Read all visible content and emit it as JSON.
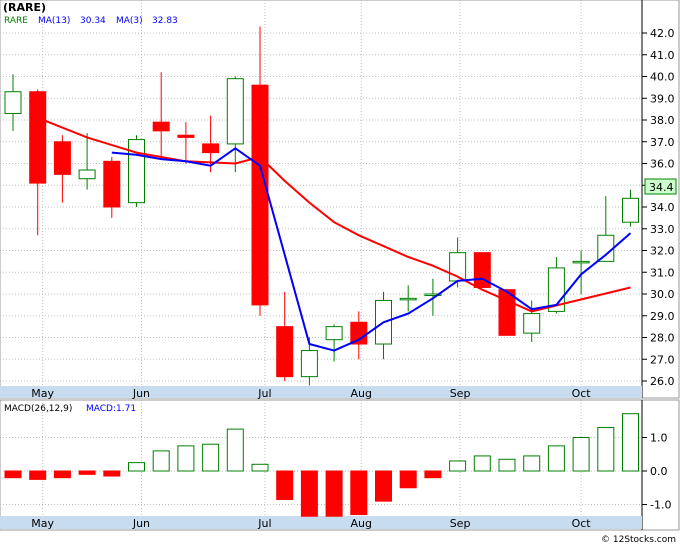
{
  "title": "(RARE)",
  "price_legend": {
    "ticker": "RARE",
    "ma13_label": "MA(13)",
    "ma13_value": "30.34",
    "ma3_label": "MA(3)",
    "ma3_value": "32.83"
  },
  "macd_legend": {
    "label": "MACD(26,12,9)",
    "value_label": "MACD:1.71"
  },
  "last_price_badge": "34.4",
  "watermark": "© 12Stocks.com",
  "colors": {
    "up": "#008000",
    "down": "#ff0000",
    "ma13": "#0000ff",
    "ma3": "#ff0000",
    "axis_band": "#c8dcf0",
    "grid": "#c0c0c0",
    "badge_bg": "#ccffcc"
  },
  "chart_data": {
    "type": "candlestick",
    "price_axis": {
      "ylim": [
        25.5,
        42.8
      ],
      "ticks": [
        "26.0",
        "27.0",
        "28.0",
        "29.0",
        "30.0",
        "31.0",
        "32.0",
        "33.0",
        "34.0",
        "35.0",
        "36.0",
        "37.0",
        "38.0",
        "39.0",
        "40.0",
        "41.0",
        "42.0"
      ]
    },
    "x_labels": [
      {
        "label": "May",
        "index": 1.2
      },
      {
        "label": "Jun",
        "index": 5.2
      },
      {
        "label": "Jul",
        "index": 10.2
      },
      {
        "label": "Aug",
        "index": 14.1
      },
      {
        "label": "Sep",
        "index": 18.1
      },
      {
        "label": "Oct",
        "index": 23.0
      }
    ],
    "candles": [
      {
        "o": 38.3,
        "h": 40.1,
        "l": 37.5,
        "c": 39.3
      },
      {
        "o": 39.3,
        "h": 39.4,
        "l": 32.7,
        "c": 35.1
      },
      {
        "o": 37.0,
        "h": 37.3,
        "l": 34.2,
        "c": 35.5
      },
      {
        "o": 35.3,
        "h": 37.4,
        "l": 34.8,
        "c": 35.7
      },
      {
        "o": 36.1,
        "h": 36.3,
        "l": 33.5,
        "c": 34.0
      },
      {
        "o": 34.2,
        "h": 37.3,
        "l": 34.0,
        "c": 37.1
      },
      {
        "o": 37.9,
        "h": 40.2,
        "l": 36.2,
        "c": 37.5
      },
      {
        "o": 37.3,
        "h": 37.9,
        "l": 36.0,
        "c": 37.2
      },
      {
        "o": 36.9,
        "h": 38.2,
        "l": 35.6,
        "c": 36.5
      },
      {
        "o": 36.9,
        "h": 40.0,
        "l": 35.6,
        "c": 39.9
      },
      {
        "o": 39.6,
        "h": 42.3,
        "l": 29.0,
        "c": 29.5
      },
      {
        "o": 28.5,
        "h": 30.1,
        "l": 26.0,
        "c": 26.2
      },
      {
        "o": 26.2,
        "h": 28.0,
        "l": 25.8,
        "c": 27.4
      },
      {
        "o": 27.9,
        "h": 28.6,
        "l": 26.9,
        "c": 28.5
      },
      {
        "o": 28.7,
        "h": 29.2,
        "l": 27.0,
        "c": 27.7
      },
      {
        "o": 27.7,
        "h": 30.1,
        "l": 27.0,
        "c": 29.7
      },
      {
        "o": 29.8,
        "h": 30.4,
        "l": 29.2,
        "c": 29.8
      },
      {
        "o": 30.0,
        "h": 30.7,
        "l": 29.0,
        "c": 30.0
      },
      {
        "o": 30.6,
        "h": 32.6,
        "l": 30.3,
        "c": 31.9
      },
      {
        "o": 31.9,
        "h": 31.9,
        "l": 30.3,
        "c": 30.3
      },
      {
        "o": 30.2,
        "h": 30.2,
        "l": 28.1,
        "c": 28.1
      },
      {
        "o": 28.2,
        "h": 29.7,
        "l": 27.8,
        "c": 29.1
      },
      {
        "o": 29.2,
        "h": 31.7,
        "l": 29.1,
        "c": 31.2
      },
      {
        "o": 31.5,
        "h": 32.0,
        "l": 30.0,
        "c": 31.5
      },
      {
        "o": 31.5,
        "h": 34.5,
        "l": 31.5,
        "c": 32.7
      },
      {
        "o": 33.3,
        "h": 34.8,
        "l": 33.1,
        "c": 34.4
      }
    ],
    "ma3": [
      null,
      null,
      null,
      null,
      36.5,
      36.4,
      36.2,
      36.1,
      35.9,
      36.7,
      35.9,
      31.8,
      27.7,
      27.4,
      27.9,
      28.7,
      29.1,
      29.8,
      30.6,
      30.7,
      30.1,
      29.3,
      29.5,
      30.9,
      31.8,
      32.8
    ],
    "ma13": [
      null,
      38.1,
      null,
      37.2,
      null,
      36.5,
      null,
      36.1,
      null,
      36.0,
      36.3,
      35.2,
      34.2,
      33.3,
      32.7,
      32.2,
      31.7,
      31.3,
      30.8,
      30.2,
      29.7,
      29.2,
      null,
      null,
      null,
      30.3
    ],
    "macd": {
      "ylim": [
        -1.35,
        1.75
      ],
      "ticks": [
        "1.0",
        "0.0",
        "-1.0"
      ],
      "values": [
        -0.2,
        -0.25,
        -0.2,
        -0.1,
        -0.15,
        0.25,
        0.6,
        0.75,
        0.8,
        1.25,
        0.2,
        -0.85,
        -1.35,
        -1.35,
        -1.3,
        -0.9,
        -0.5,
        -0.2,
        0.3,
        0.45,
        0.35,
        0.45,
        0.75,
        1.0,
        1.3,
        1.71
      ]
    }
  }
}
